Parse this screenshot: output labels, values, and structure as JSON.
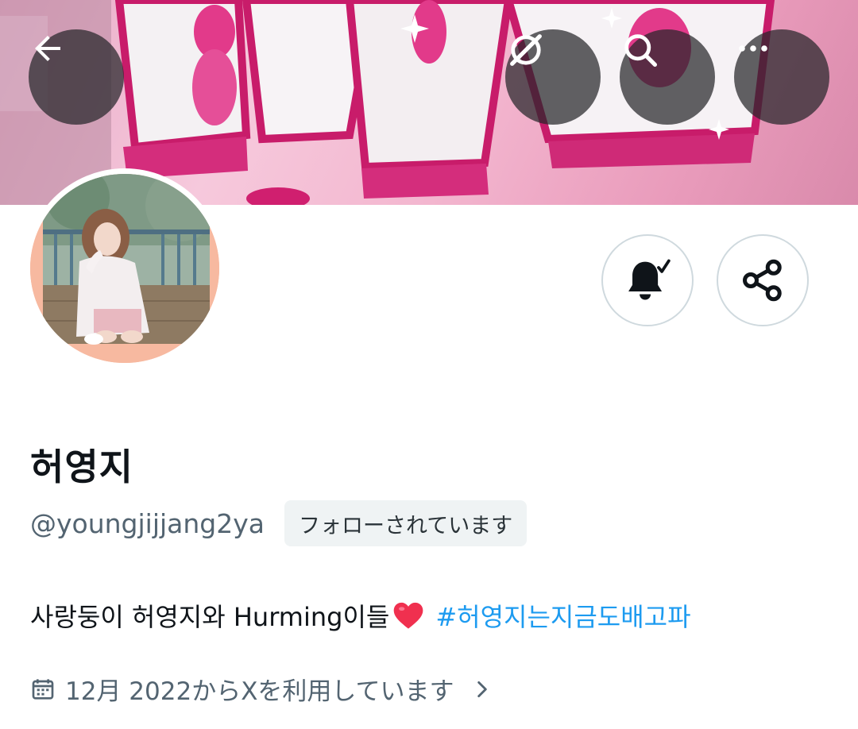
{
  "header": {
    "back_icon": "arrow-left-icon",
    "grok_icon": "grok-icon",
    "search_icon": "search-icon",
    "more_icon": "more-horizontal-icon"
  },
  "profile": {
    "display_name": "허영지",
    "handle": "@youngjijjang2ya",
    "follows_you_label": "フォローされています",
    "bio_text": "사랑둥이 허영지와 Hurming이들",
    "bio_emoji": "heart-emoji",
    "bio_hashtag": "#허영지는지금도배고파",
    "joined_text": "12月 2022からXを利用しています"
  },
  "actions": {
    "notify_icon": "bell-check-icon",
    "share_icon": "share-icon"
  },
  "colors": {
    "link": "#1d9bf0",
    "secondary_text": "#536471",
    "primary_text": "#0f1419",
    "avatar_border_bg": "#f7b9a0"
  }
}
